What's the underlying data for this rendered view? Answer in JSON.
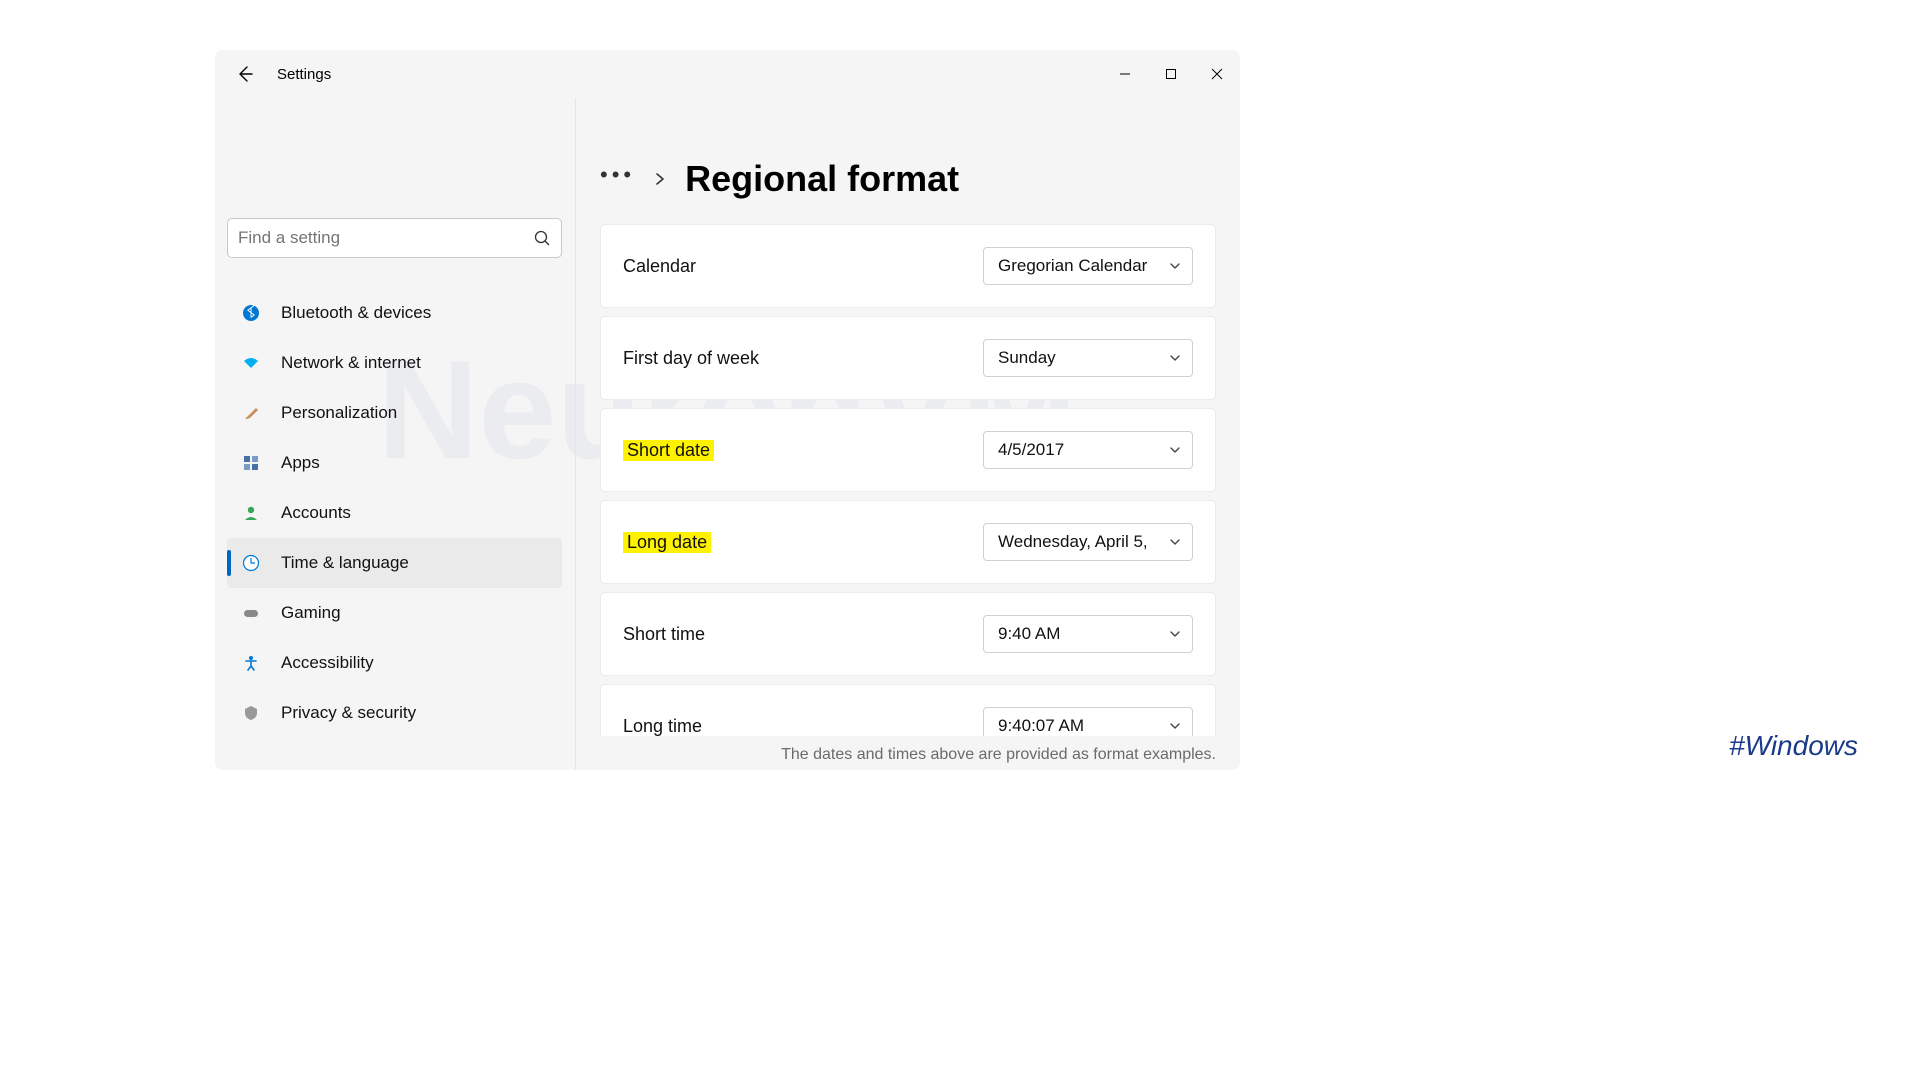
{
  "titlebar": {
    "title": "Settings"
  },
  "search": {
    "placeholder": "Find a setting"
  },
  "sidebar": {
    "items": [
      {
        "label": "Bluetooth & devices"
      },
      {
        "label": "Network & internet"
      },
      {
        "label": "Personalization"
      },
      {
        "label": "Apps"
      },
      {
        "label": "Accounts"
      },
      {
        "label": "Time & language"
      },
      {
        "label": "Gaming"
      },
      {
        "label": "Accessibility"
      },
      {
        "label": "Privacy & security"
      }
    ]
  },
  "page": {
    "title": "Regional format",
    "settings": {
      "calendar": {
        "label": "Calendar",
        "value": "Gregorian Calendar"
      },
      "firstday": {
        "label": "First day of week",
        "value": "Sunday"
      },
      "shortdate": {
        "label": "Short date",
        "value": "4/5/2017"
      },
      "longdate": {
        "label": "Long date",
        "value": "Wednesday, April 5,"
      },
      "shorttime": {
        "label": "Short time",
        "value": "9:40 AM"
      },
      "longtime": {
        "label": "Long time",
        "value": "9:40:07 AM"
      }
    },
    "note": "The dates and times above are provided as format examples."
  },
  "hashtag": "#Windows",
  "watermark": "NeuronVM"
}
